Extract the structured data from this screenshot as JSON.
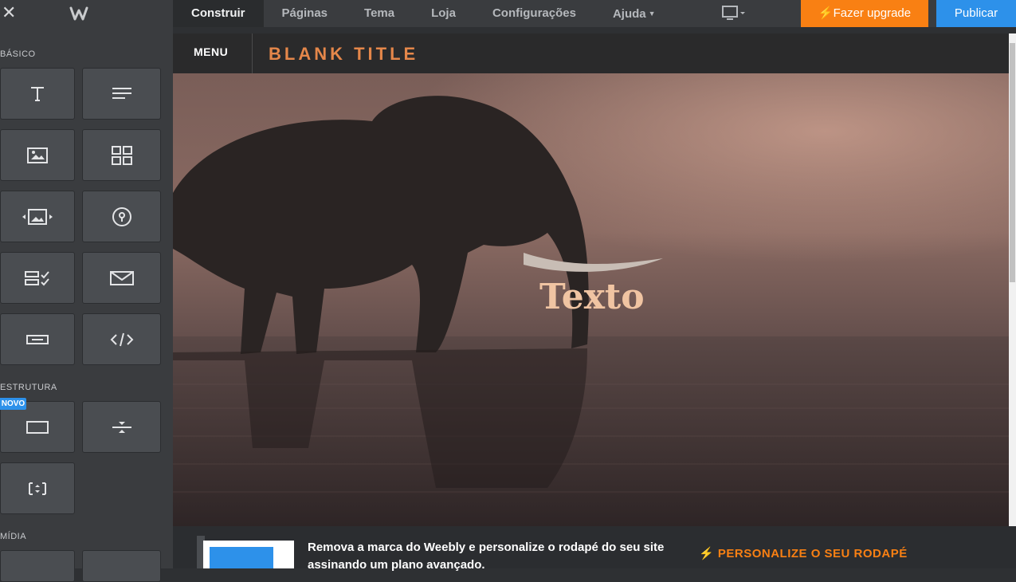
{
  "topbar": {
    "tabs": [
      {
        "label": "Construir"
      },
      {
        "label": "Páginas"
      },
      {
        "label": "Tema"
      },
      {
        "label": "Loja"
      },
      {
        "label": "Configurações"
      },
      {
        "label": "Ajuda"
      }
    ],
    "upgrade_label": "Fazer upgrade",
    "publish_label": "Publicar"
  },
  "sidebar": {
    "sections": {
      "basic": "BÁSICO",
      "structure": "ESTRUTURA",
      "media": "MÍDIA"
    },
    "new_badge": "NOVO"
  },
  "site": {
    "menu_label": "MENU",
    "title": "BLANK TITLE",
    "hero_text": "Texto"
  },
  "footer": {
    "message": "Remova a marca do Weebly e personalize o rodapé do seu site assinando um plano avançado.",
    "cta": "PERSONALIZE O SEU RODAPÉ"
  },
  "colors": {
    "accent_orange": "#f98013",
    "accent_blue": "#2d91ea",
    "title_orange": "#e5874a"
  }
}
